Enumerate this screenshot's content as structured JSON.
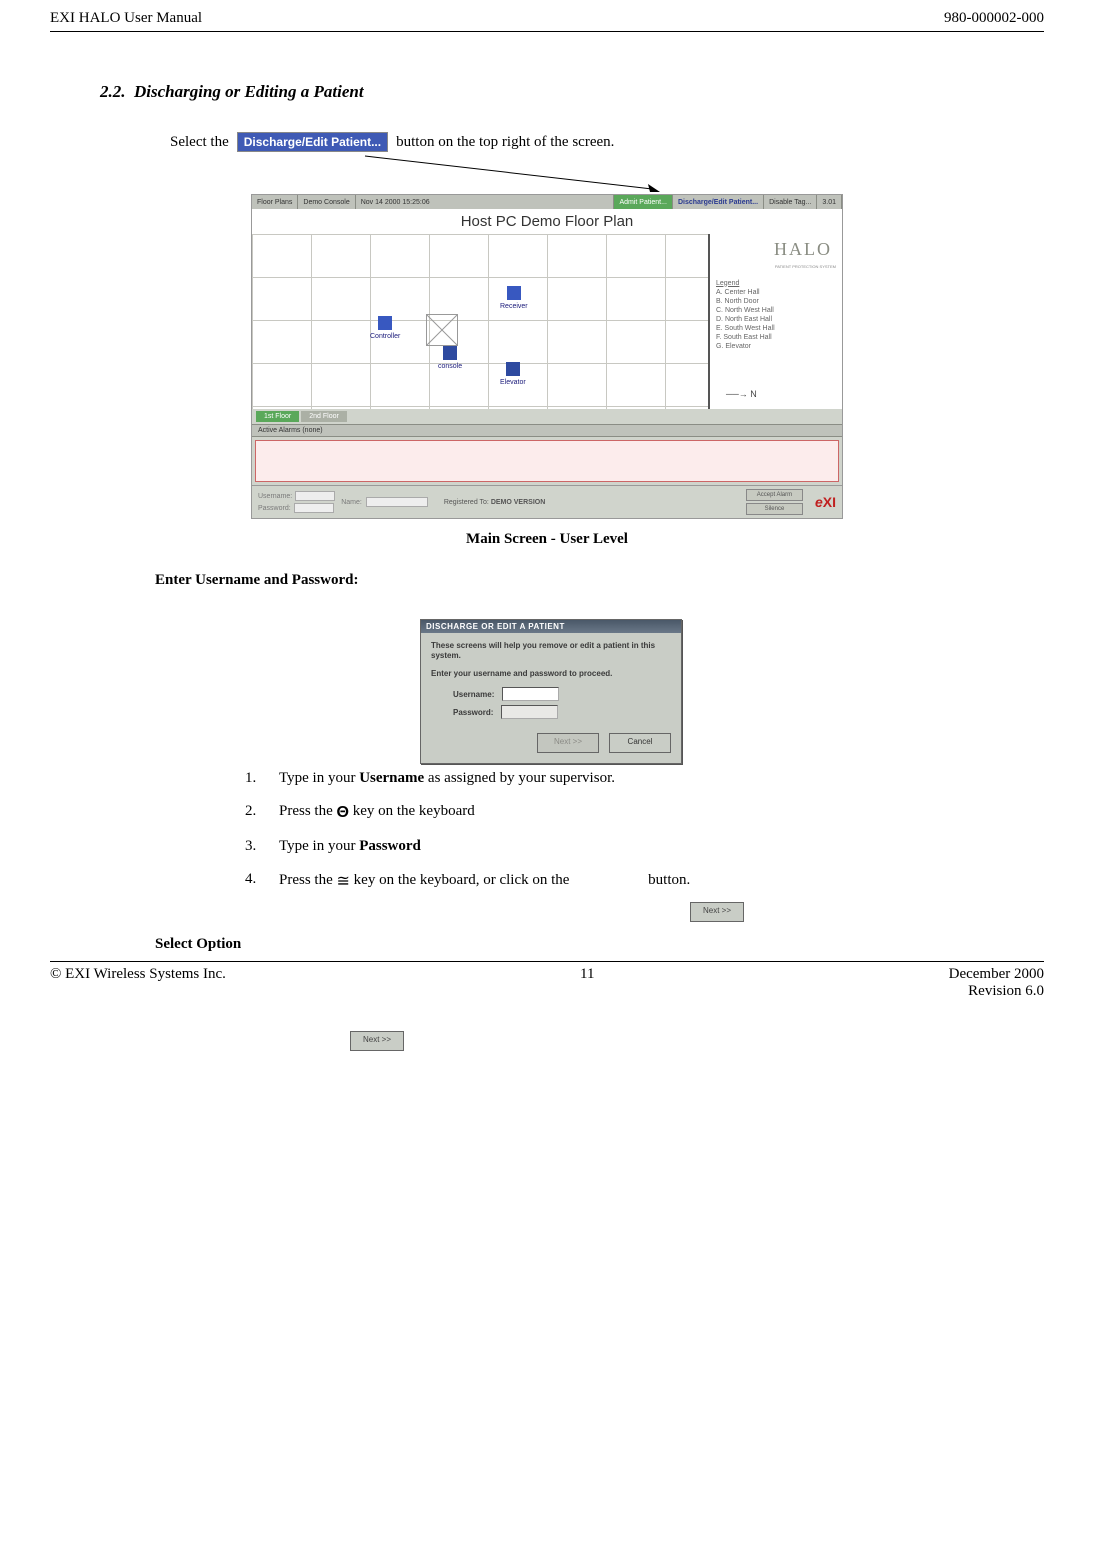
{
  "header": {
    "left": "EXI HALO User Manual",
    "right": "980-000002-000"
  },
  "section": {
    "number": "2.2.",
    "title": "Discharging or Editing a Patient"
  },
  "instructions": {
    "select_prefix": "Select the ",
    "discharge_button_label": "Discharge/Edit Patient...",
    "select_suffix": " button on the top right of the screen."
  },
  "main_app": {
    "toolbar": {
      "floor_plans": "Floor Plans",
      "demo_console": "Demo Console",
      "datetime": "Nov 14 2000  15:25:06",
      "admit": "Admit Patient...",
      "discharge": "Discharge/Edit Patient...",
      "disable_tag": "Disable Tag...",
      "version": "3.01"
    },
    "title": "Host PC Demo Floor Plan",
    "floor_items": {
      "controller": "Controller",
      "console": "console",
      "receiver": "Receiver",
      "elevator": "Elevator"
    },
    "legend_pane": {
      "logo": "HALO",
      "subtitle": "PATIENT PROTECTION SYSTEM",
      "heading": "Legend",
      "items": [
        "A.  Center Hall",
        "B.  North Door",
        "C.  North West Hall",
        "D.  North East Hall",
        "E.  South West Hall",
        "F.  South East Hall",
        "G.  Elevator"
      ],
      "north_arrow": "──→  N"
    },
    "floor_tabs": {
      "tab1": "1st Floor",
      "tab2": "2nd Floor"
    },
    "alarms_header": "Active Alarms (none)",
    "bottom_bar": {
      "username": "Username:",
      "password": "Password:",
      "name": "Name:",
      "registered_prefix": "Registered To:   ",
      "registered_value": "DEMO VERSION",
      "btn_accept": "Accept Alarm",
      "btn_silence": "Silence",
      "exi_logo1": "e",
      "exi_logo2": "XI"
    }
  },
  "caption_main": "Main Screen - User Level",
  "subheading1": "Enter Username and Password:",
  "dialog": {
    "title": "DISCHARGE OR EDIT A PATIENT",
    "help1": "These screens will help you remove or edit a patient in this system.",
    "help2": "Enter your username and password to proceed.",
    "username_label": "Username:",
    "password_label": "Password:",
    "next": "Next >>",
    "cancel": "Cancel"
  },
  "steps": {
    "s1_a": "Type in your ",
    "s1_b": "Username",
    "s1_c": " as assigned by your supervisor.",
    "s2_a": "Press the ",
    "s2_b": " key on the keyboard",
    "s3_a": "Type in your ",
    "s3_b": "Password",
    "s4_a": "Press the ",
    "s4_b": " key on the keyboard, or click on the",
    "s4_c": "button.",
    "theta": "Θ",
    "cong": "≅",
    "next_label": "Next >>"
  },
  "select_option": "Select Option",
  "footer": {
    "left": "© EXI Wireless Systems Inc.",
    "center": "11",
    "right1": "December 2000",
    "right2": "Revision 6.0"
  },
  "extra_next": "Next >>"
}
